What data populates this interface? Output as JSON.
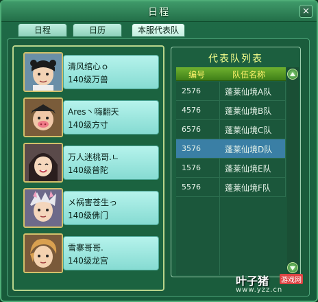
{
  "window": {
    "title": "日程",
    "close_icon": "close-icon"
  },
  "tabs": [
    {
      "label": "日程",
      "active": false
    },
    {
      "label": "日历",
      "active": false
    },
    {
      "label": "本服代表队",
      "active": true
    }
  ],
  "members": [
    {
      "name": "清风绾心ｏ",
      "level": "140级万兽",
      "avatar": "avatar-wanshou"
    },
    {
      "name": "Ares丶嗨翻天",
      "level": "140级方寸",
      "avatar": "avatar-fangcun"
    },
    {
      "name": "万人迷桃哥.ㄴ",
      "level": "140级普陀",
      "avatar": "avatar-putuo"
    },
    {
      "name": "メ祸害苍生っ",
      "level": "140级佛门",
      "avatar": "avatar-fomen"
    },
    {
      "name": "雪寨哥哥.",
      "level": "140级龙宫",
      "avatar": "avatar-longgong"
    }
  ],
  "team_list": {
    "title": "代表队列表",
    "headers": {
      "id": "编号",
      "name": "队伍名称"
    },
    "rows": [
      {
        "id": "2576",
        "name": "蓬莱仙境A队",
        "selected": false
      },
      {
        "id": "4576",
        "name": "蓬莱仙境B队",
        "selected": false
      },
      {
        "id": "6576",
        "name": "蓬莱仙境C队",
        "selected": false
      },
      {
        "id": "3576",
        "name": "蓬莱仙境D队",
        "selected": true
      },
      {
        "id": "1576",
        "name": "蓬莱仙境E队",
        "selected": false
      },
      {
        "id": "5576",
        "name": "蓬莱仙境F队",
        "selected": false
      }
    ]
  },
  "watermark": {
    "site": "叶子猪",
    "tag": "游戏网",
    "url": "www.yzz.cn"
  },
  "colors": {
    "accent": "#3a7fa5",
    "header": "#6fb12f",
    "card": "#b6f3ec"
  }
}
